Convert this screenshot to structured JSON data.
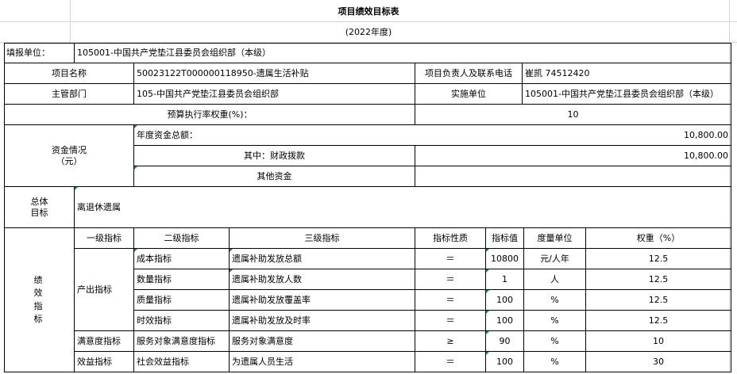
{
  "title": "项目绩效目标表",
  "year": "(2022年度)",
  "header": {
    "reporting_unit_label": "填报单位：",
    "reporting_unit": "105001-中国共产党垫江县委员会组织部（本级）",
    "project_name_label": "项目名称",
    "project_name": "50023122T000000118950-遗属生活补贴",
    "contact_label": "项目负责人及联系电话",
    "contact": "崔凯 74512420",
    "department_label": "主管部门",
    "department": "105-中国共产党垫江县委员会组织部",
    "impl_unit_label": "实施单位",
    "impl_unit": "105001-中国共产党垫江县委员会组织部（本级）",
    "budget_weight_label": "预算执行率权重(%)：",
    "budget_weight": "10"
  },
  "funds": {
    "label_line1": "资金情况",
    "label_line2": "（元）",
    "total_label": "年度资金总额：",
    "total": "10,800.00",
    "fiscal_label": "其中：财政拨款",
    "fiscal": "10,800.00",
    "other_label": "其他资金",
    "other": ""
  },
  "overall": {
    "label_line1": "总体",
    "label_line2": "目标",
    "text": "离退休遗属"
  },
  "indicators": {
    "section_label": "绩效指标",
    "headers": {
      "level1": "一级指标",
      "level2": "二级指标",
      "level3": "三级指标",
      "nature": "指标性质",
      "value": "指标值",
      "unit": "度量单位",
      "weight": "权重（%）"
    },
    "output_label": "产出指标",
    "rows": [
      {
        "level2": "成本指标",
        "level3": "遗属补助发放总额",
        "nature": "＝",
        "value": "10800",
        "unit": "元/人年",
        "weight": "12.5"
      },
      {
        "level2": "数量指标",
        "level3": "遗属补助发放人数",
        "nature": "＝",
        "value": "1",
        "unit": "人",
        "weight": "12.5"
      },
      {
        "level2": "质量指标",
        "level3": "遗属补助发放覆盖率",
        "nature": "＝",
        "value": "100",
        "unit": "%",
        "weight": "12.5"
      },
      {
        "level2": "时效指标",
        "level3": "遗属补助发放及时率",
        "nature": "＝",
        "value": "100",
        "unit": "%",
        "weight": "12.5"
      },
      {
        "level1": "满意度指标",
        "level2": "服务对象满意度指标",
        "level3": "服务对象满意度",
        "nature": "≥",
        "value": "90",
        "unit": "%",
        "weight": "10"
      },
      {
        "level1": "效益指标",
        "level2": "社会效益指标",
        "level3": "为遗属人员生活",
        "nature": "＝",
        "value": "100",
        "unit": "%",
        "weight": "30"
      }
    ]
  }
}
